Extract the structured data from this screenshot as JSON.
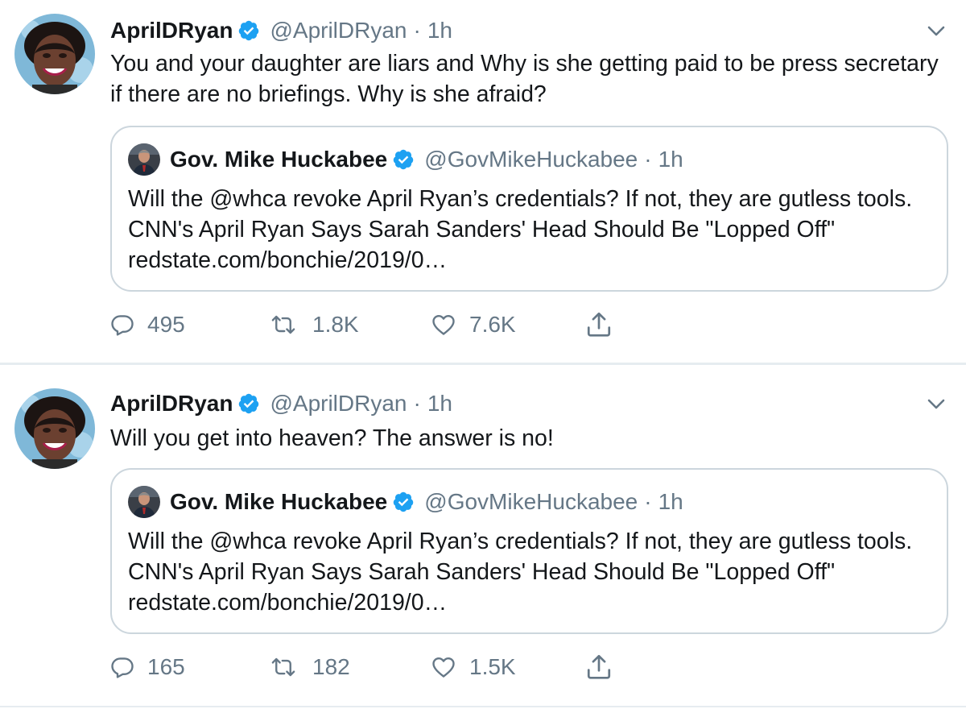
{
  "colors": {
    "text": "#14171a",
    "secondary": "#657786",
    "verified": "#1da1f2",
    "border": "#ccd6dd",
    "divider": "#e6ecf0"
  },
  "icons": [
    "chevron-down-icon",
    "verified-badge-icon",
    "reply-icon",
    "retweet-icon",
    "like-icon",
    "share-icon"
  ],
  "tweets": [
    {
      "author": {
        "name": "AprilDRyan",
        "handle": "@AprilDRyan",
        "time": "1h"
      },
      "separator": "·",
      "text": "You and your daughter are liars and Why is she getting paid to be press secretary if there are no briefings. Why is she afraid?",
      "quoted": {
        "author": {
          "name": "Gov. Mike Huckabee",
          "handle": "@GovMikeHuckabee",
          "time": "1h"
        },
        "separator": "·",
        "text": "Will the @whca revoke April Ryan’s credentials?  If not, they are gutless tools.   CNN's April Ryan Says Sarah Sanders' Head Should Be \"Lopped Off\" redstate.com/bonchie/2019/0…"
      },
      "stats": {
        "replies": "495",
        "retweets": "1.8K",
        "likes": "7.6K"
      }
    },
    {
      "author": {
        "name": "AprilDRyan",
        "handle": "@AprilDRyan",
        "time": "1h"
      },
      "separator": "·",
      "text": "Will you get into heaven? The answer is no!",
      "quoted": {
        "author": {
          "name": "Gov. Mike Huckabee",
          "handle": "@GovMikeHuckabee",
          "time": "1h"
        },
        "separator": "·",
        "text": "Will the @whca revoke April Ryan’s credentials?  If not, they are gutless tools.   CNN's April Ryan Says Sarah Sanders' Head Should Be \"Lopped Off\" redstate.com/bonchie/2019/0…"
      },
      "stats": {
        "replies": "165",
        "retweets": "182",
        "likes": "1.5K"
      }
    }
  ]
}
